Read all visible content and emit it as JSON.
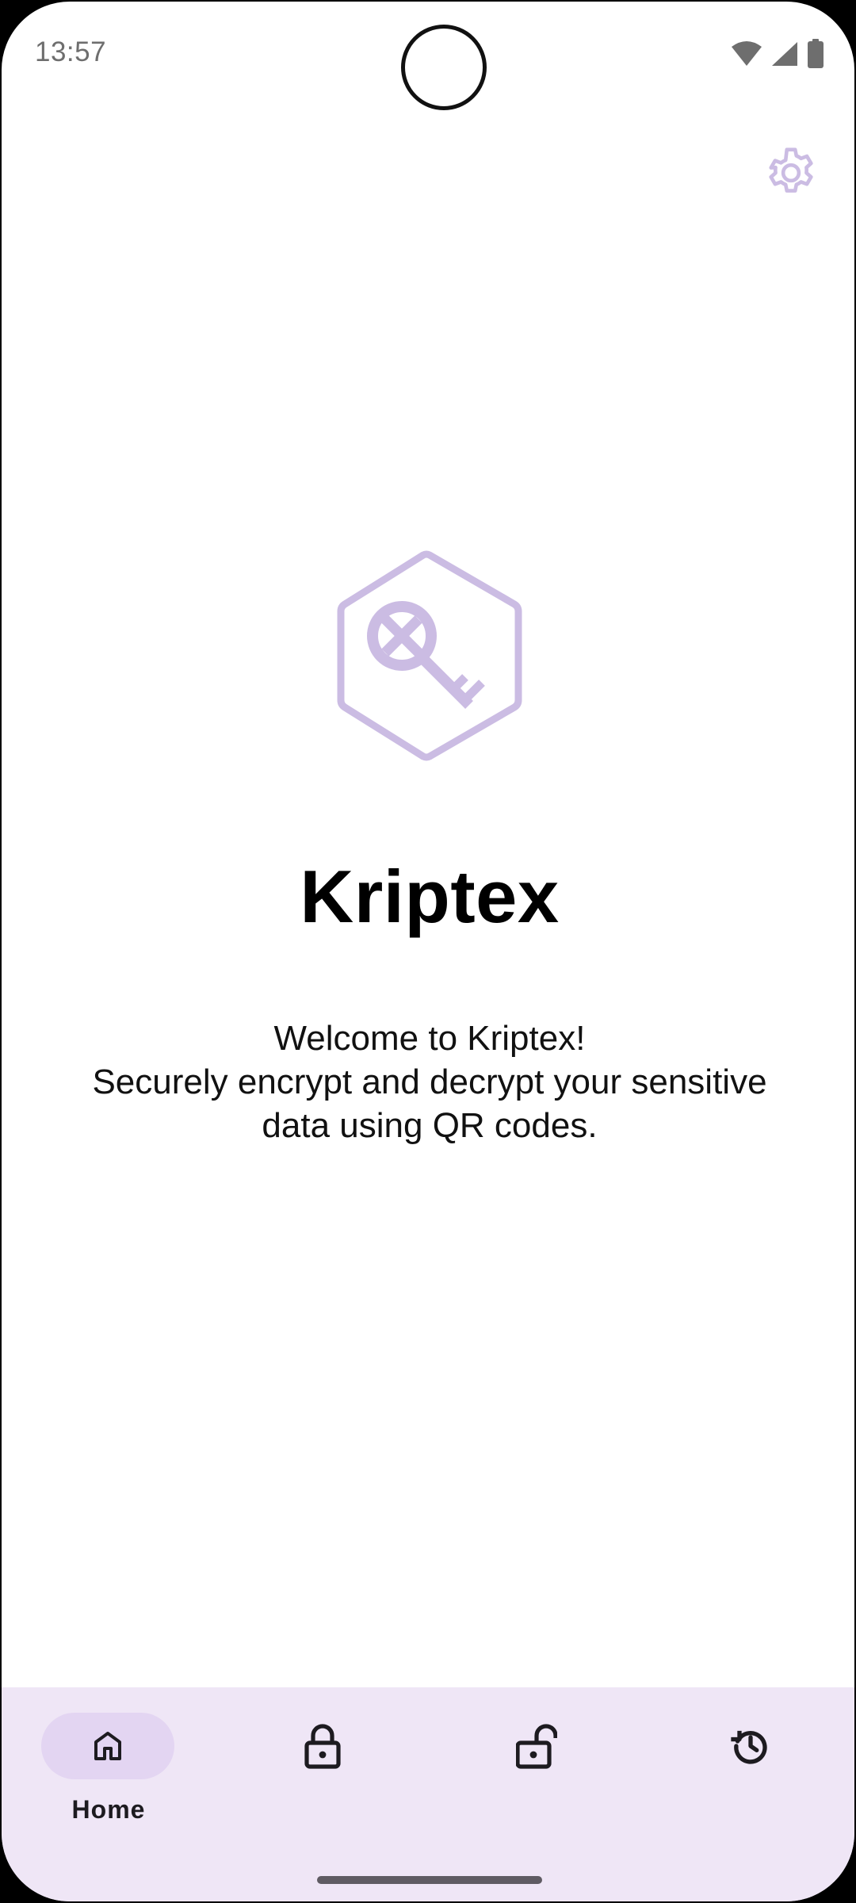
{
  "status_bar": {
    "time": "13:57",
    "icons": [
      "wifi-icon",
      "cellular-signal-icon",
      "battery-icon"
    ]
  },
  "header": {
    "settings_icon": "gear-icon"
  },
  "hero": {
    "logo_icon": "hexagon-key-icon",
    "title": "Kriptex",
    "welcome_lines": [
      "Welcome to Kriptex!",
      "Securely encrypt and decrypt your sensitive",
      "data using QR codes."
    ]
  },
  "bottom_nav": {
    "items": [
      {
        "label": "Home",
        "icon": "home-icon",
        "selected": true
      },
      {
        "label": "",
        "icon": "lock-icon",
        "selected": false
      },
      {
        "label": "",
        "icon": "unlock-icon",
        "selected": false
      },
      {
        "label": "",
        "icon": "history-icon",
        "selected": false
      }
    ]
  },
  "colors": {
    "accent_light": "#cbbce3",
    "nav_background": "#efe6f6",
    "nav_pill": "#e3d5f2",
    "icon_dark": "#1d1b20"
  }
}
